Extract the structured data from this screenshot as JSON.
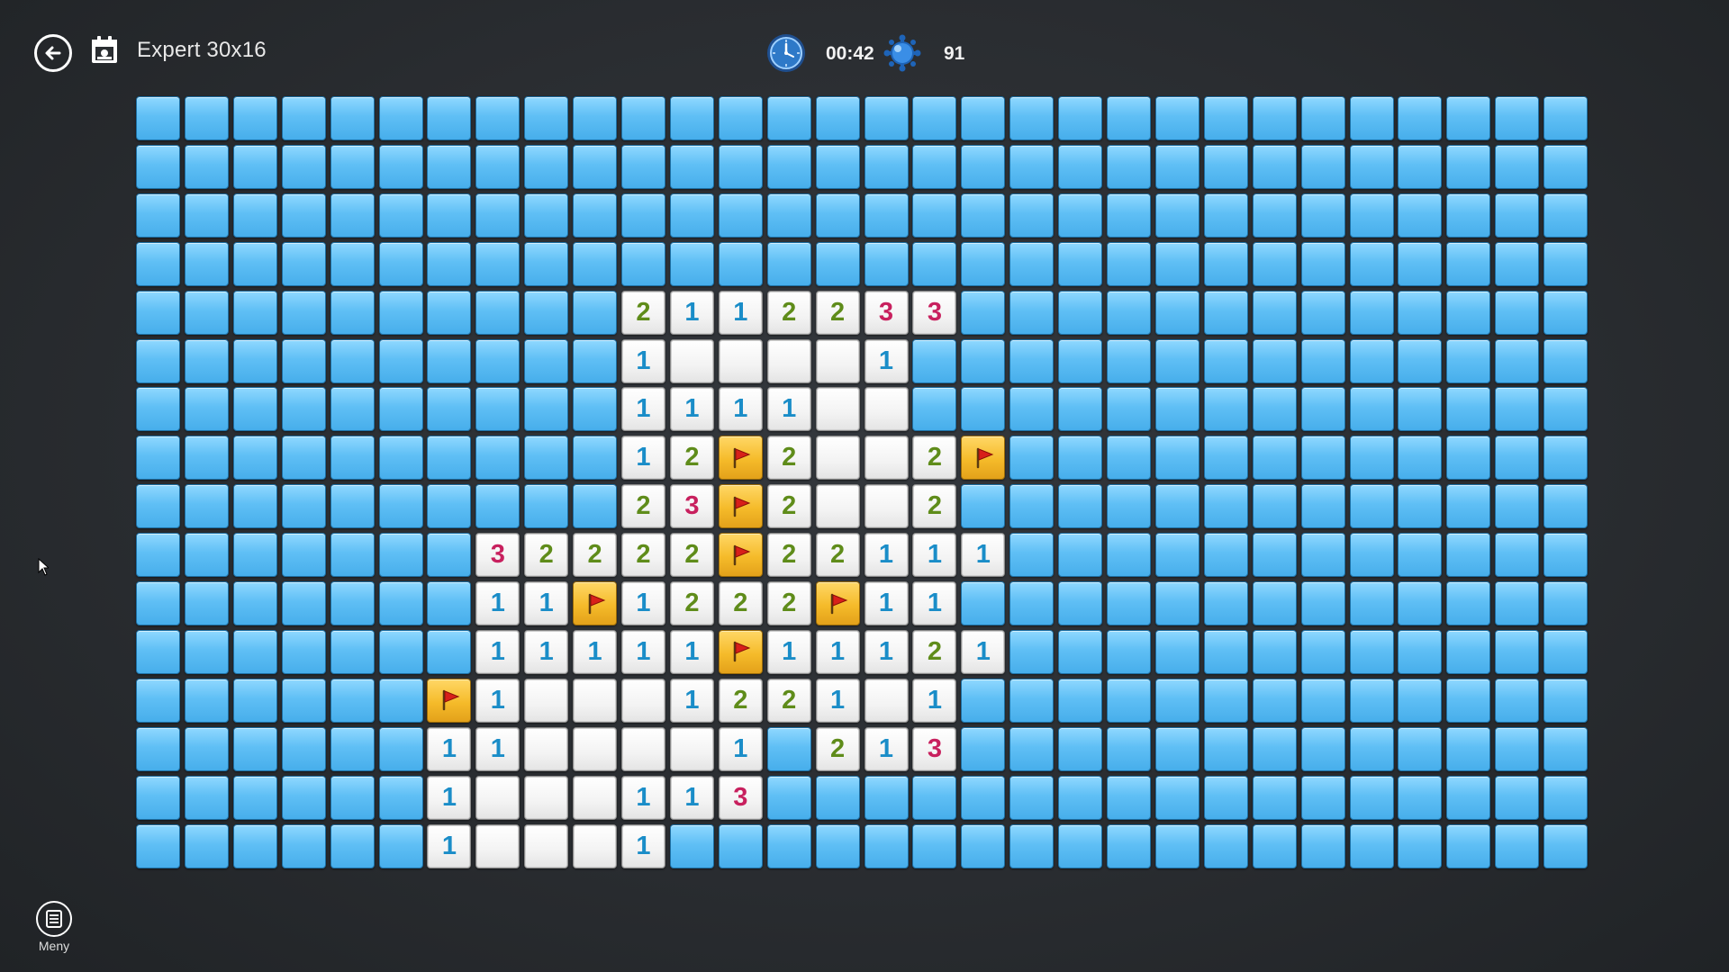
{
  "header": {
    "title": "Expert 30x16",
    "time": "00:42",
    "mines_remaining": "91"
  },
  "menu": {
    "label": "Meny"
  },
  "icons": {
    "back": "back-arrow-icon",
    "calendar": "daily-challenge-calendar-icon",
    "clock": "clock-icon",
    "mine": "mine-icon",
    "menu": "menu-list-icon",
    "flag": "flag-icon"
  },
  "colors": {
    "hidden_tile": "#5fbff5",
    "flag_tile": "#f5bb2a",
    "number_1": "#1a8dc8",
    "number_2": "#5f8c1a",
    "number_3": "#c8205e"
  },
  "board": {
    "cols": 30,
    "rows": 16,
    "legend": "# = hidden, F = flag, 0 = revealed empty, 1-3 = revealed number",
    "grid": [
      "##############################",
      "##############################",
      "##############################",
      "##############################",
      "##########2112233#############",
      "##########100001##############",
      "##########111100##############",
      "##########12F2002F############",
      "##########23F2002#############",
      "#######32222F22111############",
      "#######11F1222F11#############",
      "#######11111F11121############",
      "######F1000122101#############",
      "######1100001#213#############",
      "######1000113#################",
      "######10001###################"
    ]
  }
}
